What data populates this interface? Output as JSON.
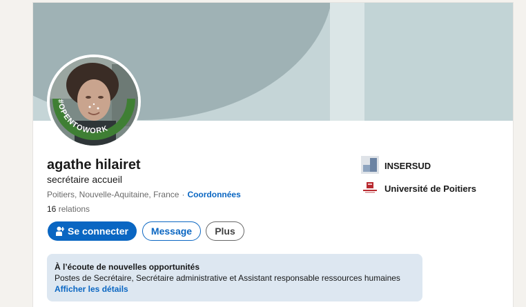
{
  "profile": {
    "name": "agathe hilairet",
    "headline": "secrétaire accueil",
    "location": "Poitiers, Nouvelle-Aquitaine, France",
    "separator": "·",
    "contact_info_link": "Coordonnées",
    "connections_count": "16",
    "connections_label": "relations",
    "open_to_work_badge": "#OPENTOWORK"
  },
  "actions": {
    "connect_label": "Se connecter",
    "message_label": "Message",
    "more_label": "Plus"
  },
  "organizations": [
    {
      "name": "INSERSUD",
      "icon": "company-logo-icon"
    },
    {
      "name": "Université de Poitiers",
      "icon": "university-logo-icon"
    }
  ],
  "open_to_work": {
    "title": "À l’écoute de nouvelles opportunités",
    "roles": "Postes de Secrétaire, Secrétaire administrative et Assistant responsable ressources humaines",
    "details_link": "Afficher les détails"
  },
  "colors": {
    "primary_blue": "#0a66c2",
    "open_to_work_green": "#3f7f34",
    "banner": "#c5d5d7",
    "open_to_work_box": "#dde7f1"
  }
}
